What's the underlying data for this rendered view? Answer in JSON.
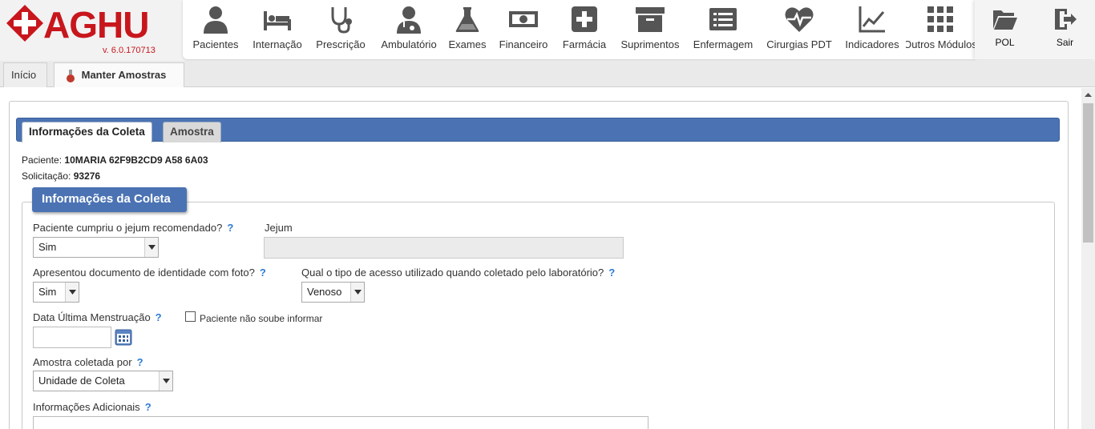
{
  "app": {
    "brand": "AGHU",
    "version": "v. 6.0.170713"
  },
  "modules": [
    {
      "label": "Pacientes",
      "icon": "person-icon"
    },
    {
      "label": "Internação",
      "icon": "bed-icon"
    },
    {
      "label": "Prescrição",
      "icon": "stethoscope-icon"
    },
    {
      "label": "Ambulatório",
      "icon": "doctor-icon"
    },
    {
      "label": "Exames",
      "icon": "flask-icon"
    },
    {
      "label": "Financeiro",
      "icon": "money-icon"
    },
    {
      "label": "Farmácia",
      "icon": "medical-cross-icon"
    },
    {
      "label": "Suprimentos",
      "icon": "archive-box-icon"
    },
    {
      "label": "Enfermagem",
      "icon": "list-document-icon"
    },
    {
      "label": "Cirurgias PDT",
      "icon": "heartbeat-icon"
    },
    {
      "label": "Indicadores",
      "icon": "line-chart-icon"
    },
    {
      "label": "Outros Módulos",
      "icon": "grid-icon"
    }
  ],
  "right_actions": {
    "pol_label": "POL",
    "sair_label": "Sair"
  },
  "page_tabs": {
    "inicio": "Início",
    "manter": "Manter Amostras",
    "close": "×"
  },
  "form_tabs": {
    "informacoes": "Informações da Coleta",
    "amostra": "Amostra"
  },
  "patient": {
    "paciente_label": "Paciente:",
    "paciente_value": "10MARIA 62F9B2CD9 A58 6A03",
    "solicitacao_label": "Solicitação:",
    "solicitacao_value": "93276"
  },
  "section": {
    "legend": "Informações da Coleta"
  },
  "fields": {
    "help_mark": "?",
    "jejum_question": "Paciente cumpriu o jejum recomendado?",
    "jejum_question_value": "Sim",
    "jejum_label": "Jejum",
    "jejum_value": "",
    "documento_question": "Apresentou documento de identidade com foto?",
    "documento_value": "Sim",
    "acesso_question": "Qual o tipo de acesso utilizado quando coletado pelo laboratório?",
    "acesso_value": "Venoso",
    "dum_label": "Data Última Menstruação",
    "dum_value": "",
    "nao_soube_label": "Paciente não soube informar",
    "nao_soube_checked": false,
    "coletada_por_label": "Amostra coletada por",
    "coletada_por_value": "Unidade de Coleta",
    "info_adicionais_label": "Informações Adicionais"
  },
  "colors": {
    "brand_red": "#c8161d",
    "tab_blue": "#4b73b4",
    "help_blue": "#2e7bd6"
  }
}
